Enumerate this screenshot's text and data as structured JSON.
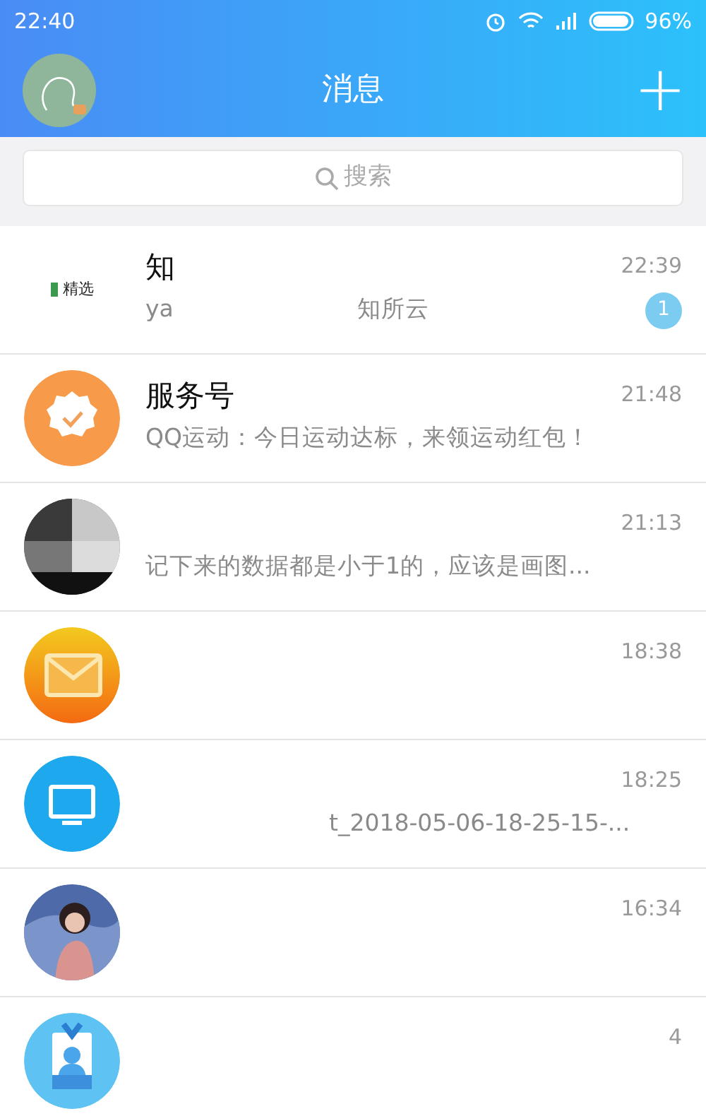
{
  "status_bar": {
    "time": "22:40",
    "battery": "96%"
  },
  "header": {
    "title": "消息",
    "add_icon": "+"
  },
  "search": {
    "placeholder": "搜索"
  },
  "conversations": [
    {
      "avatar": {
        "kind": "logo",
        "text": "精选"
      },
      "title": "知",
      "preview": "ya",
      "preview_tail": "知所云",
      "time": "22:39",
      "unread": "1"
    },
    {
      "avatar": {
        "kind": "service"
      },
      "title": "服务号",
      "preview": "QQ运动：今日运动达标，来领运动红包！",
      "time": "21:48"
    },
    {
      "preview": "记下来的数据都是小于1的，应该是画图...",
      "time": "21:13"
    },
    {
      "avatar": {
        "kind": "mail"
      },
      "time": "18:38"
    },
    {
      "avatar": {
        "kind": "computer"
      },
      "preview_tail": "t_2018-05-06-18-25-15-...",
      "time": "18:25"
    },
    {
      "avatar": {
        "kind": "figure"
      },
      "time": "16:34"
    },
    {
      "avatar": {
        "kind": "idcard"
      },
      "time": "4"
    }
  ]
}
